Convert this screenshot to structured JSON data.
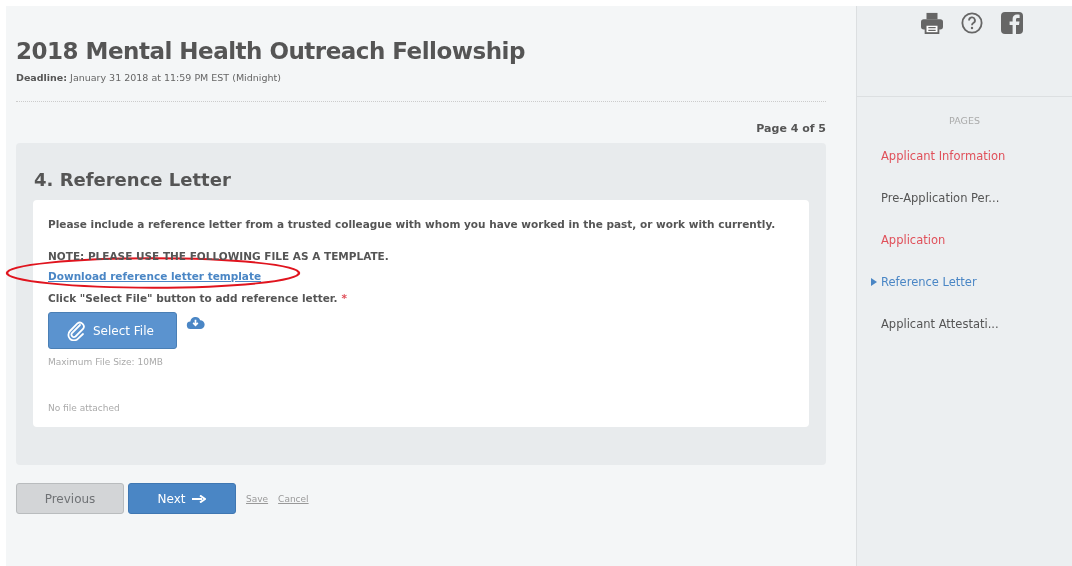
{
  "title": "2018 Mental Health Outreach Fellowship",
  "deadline": {
    "label": "Deadline:",
    "value": "January 31 2018 at 11:59 PM EST (Midnight)"
  },
  "page_indicator": "Page 4 of 5",
  "section": {
    "heading": "4. Reference Letter",
    "instructions": "Please include a reference letter from a trusted colleague with whom you have worked in the past, or work with currently.",
    "note": "NOTE: PLEASE USE THE FOLLOWING FILE AS A TEMPLATE.",
    "template_link": "Download reference letter template",
    "upload_label": "Click \"Select File\" button to add reference letter.",
    "required_mark": "*",
    "select_button": "Select File",
    "max_size": "Maximum File Size: 10MB",
    "file_status": "No file attached"
  },
  "buttons": [
    {
      "label": "Previous",
      "disabled": true
    },
    {
      "label": "Next",
      "disabled": false
    }
  ],
  "links": [
    "Save",
    "Cancel"
  ],
  "sidebar": {
    "heading": "PAGES",
    "items": [
      {
        "label": "Applicant Information",
        "selected": false,
        "error": true
      },
      {
        "label": "Pre-Application Per...",
        "selected": false,
        "error": false
      },
      {
        "label": "Application",
        "selected": false,
        "error": true
      },
      {
        "label": "Reference Letter",
        "selected": true,
        "error": false
      },
      {
        "label": "Applicant Attestati...",
        "selected": false,
        "error": false
      }
    ]
  }
}
